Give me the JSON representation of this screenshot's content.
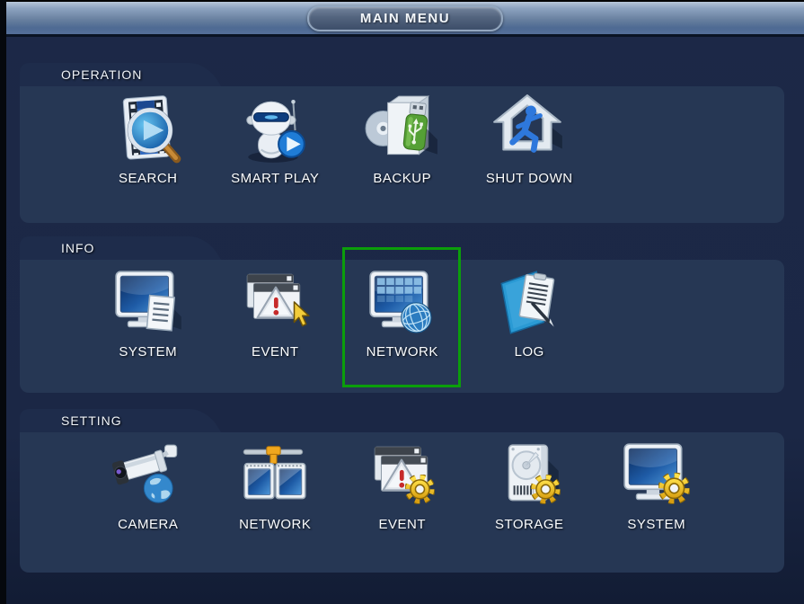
{
  "header": {
    "title": "MAIN MENU"
  },
  "colors": {
    "background": "#1b2745",
    "panel": "#263754",
    "tab": "#1e2c4b",
    "topbar": "#8da3c0",
    "selection_green": "#0b9e0b"
  },
  "sections": [
    {
      "label": "OPERATION",
      "items": [
        {
          "label": "SEARCH",
          "icon": "search-icon"
        },
        {
          "label": "SMART PLAY",
          "icon": "smart-play-icon"
        },
        {
          "label": "BACKUP",
          "icon": "backup-icon"
        },
        {
          "label": "SHUT DOWN",
          "icon": "shutdown-icon"
        }
      ]
    },
    {
      "label": "INFO",
      "items": [
        {
          "label": "SYSTEM",
          "icon": "system-info-icon"
        },
        {
          "label": "EVENT",
          "icon": "event-info-icon"
        },
        {
          "label": "NETWORK",
          "icon": "network-info-icon",
          "selected": true
        },
        {
          "label": "LOG",
          "icon": "log-icon"
        }
      ]
    },
    {
      "label": "SETTING",
      "items": [
        {
          "label": "CAMERA",
          "icon": "camera-icon"
        },
        {
          "label": "NETWORK",
          "icon": "network-setting-icon"
        },
        {
          "label": "EVENT",
          "icon": "event-setting-icon"
        },
        {
          "label": "STORAGE",
          "icon": "storage-icon"
        },
        {
          "label": "SYSTEM",
          "icon": "system-setting-icon"
        }
      ]
    }
  ]
}
